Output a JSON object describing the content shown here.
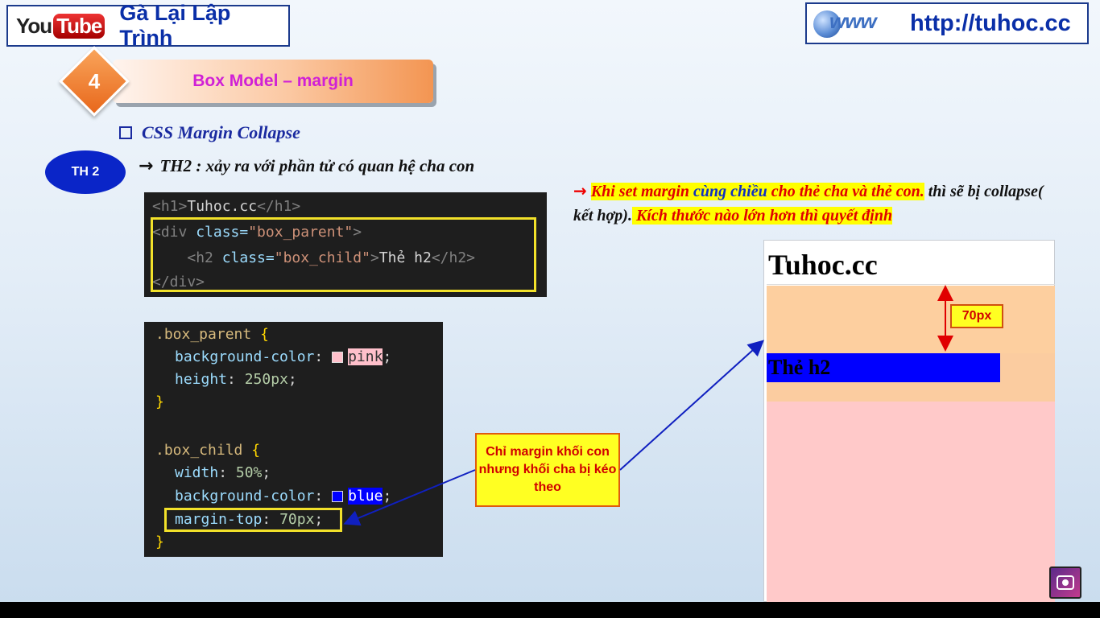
{
  "header": {
    "yt_you": "You",
    "yt_tube": "Tube",
    "channel": "Gà Lại Lập Trình",
    "www_text": "www",
    "url": "http://tuhoc.cc"
  },
  "lesson": {
    "number": "4",
    "title": "Box Model – margin"
  },
  "section": {
    "title": "CSS Margin Collapse"
  },
  "case": {
    "badge": "TH 2",
    "text": "TH2 : xảy ra với  phần tử có quan hệ cha con"
  },
  "html_code": {
    "line1": {
      "open": "<h1>",
      "text": "Tuhoc.cc",
      "close": "</h1>"
    },
    "line2": {
      "tag_open": "<div",
      "attr": " class=",
      "value": "\"box_parent\"",
      "tag_close": ">"
    },
    "line3": {
      "indent": "    ",
      "tag_open": "<h2",
      "attr": " class=",
      "value": "\"box_child\"",
      "tag_close": ">",
      "text": "Thẻ h2",
      "close": "</h2>"
    },
    "line4": {
      "close": "</div>"
    }
  },
  "css_code": {
    "parent_selector": ".box_parent",
    "open_brace": "{",
    "close_brace": "}",
    "parent_bg_prop": "background-color",
    "parent_bg_val": "pink",
    "parent_h_prop": "height",
    "parent_h_val": "250px",
    "child_selector": ".box_child",
    "child_w_prop": "width",
    "child_w_val": "50%",
    "child_bg_prop": "background-color",
    "child_bg_val": "blue",
    "child_mt_prop": "margin-top",
    "child_mt_val": "70px",
    "colon": ": ",
    "semicolon": ";"
  },
  "note": {
    "arrow": "→",
    "part1": "Khi set margin",
    "part2": " cùng chiều",
    "part3": " cho thẻ cha và thẻ con.",
    "part4": " thì sẽ bị collapse( kết hợp).",
    "part5": " Kích thước nào lớn hơn thì quyết định"
  },
  "callout": {
    "text": "Chỉ margin khối con nhưng khối cha bị kéo theo"
  },
  "preview": {
    "h1": "Tuhoc.cc",
    "h2": "Thẻ h2",
    "measure": "70px"
  },
  "colors": {
    "accent_blue": "#0a2fa8",
    "pink": "#ffc9c9",
    "margin_orange": "#fdcf9f",
    "child_blue": "#0000ff",
    "highlight_yellow": "#ffff00",
    "red_text": "#e00000"
  },
  "icons": [
    "youtube-logo",
    "www-globe-logo",
    "checkbox-icon",
    "arrow-right-icon",
    "channel-avatar-icon"
  ]
}
